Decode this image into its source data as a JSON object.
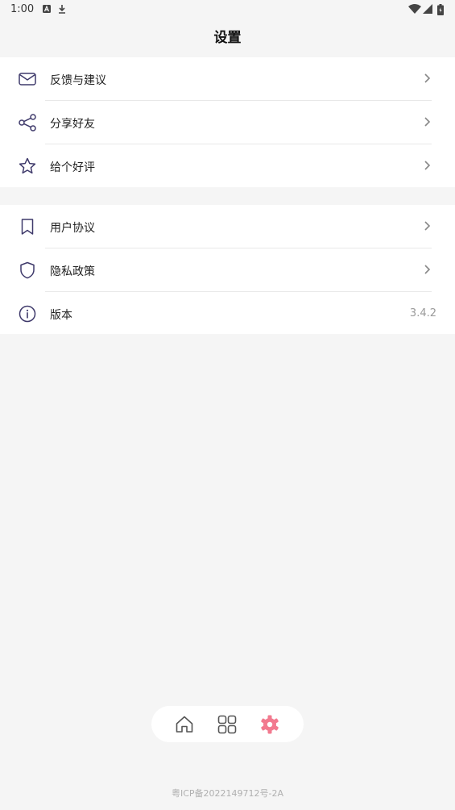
{
  "status_bar": {
    "time": "1:00",
    "icons": [
      "a-icon",
      "download-icon",
      "wifi-icon",
      "signal-icon",
      "battery-icon"
    ]
  },
  "header": {
    "title": "设置"
  },
  "settings": {
    "group1": [
      {
        "label": "反馈与建议",
        "icon": "mail-icon"
      },
      {
        "label": "分享好友",
        "icon": "share-icon"
      },
      {
        "label": "给个好评",
        "icon": "star-icon"
      }
    ],
    "group2": [
      {
        "label": "用户协议",
        "icon": "bookmark-icon"
      },
      {
        "label": "隐私政策",
        "icon": "shield-icon"
      },
      {
        "label": "版本",
        "icon": "info-icon",
        "value": "3.4.2"
      }
    ]
  },
  "tab_bar": {
    "tabs": [
      {
        "name": "home",
        "icon": "home-icon",
        "active": false
      },
      {
        "name": "grid",
        "icon": "grid-icon",
        "active": false
      },
      {
        "name": "settings",
        "icon": "gear-icon",
        "active": true
      }
    ],
    "active_color": "#f27a8f",
    "inactive_color": "#555555"
  },
  "footer": {
    "icp": "粤ICP备2022149712号-2A"
  },
  "colors": {
    "icon_stroke": "#3f3a6b",
    "background": "#f5f5f5",
    "card": "#ffffff"
  }
}
